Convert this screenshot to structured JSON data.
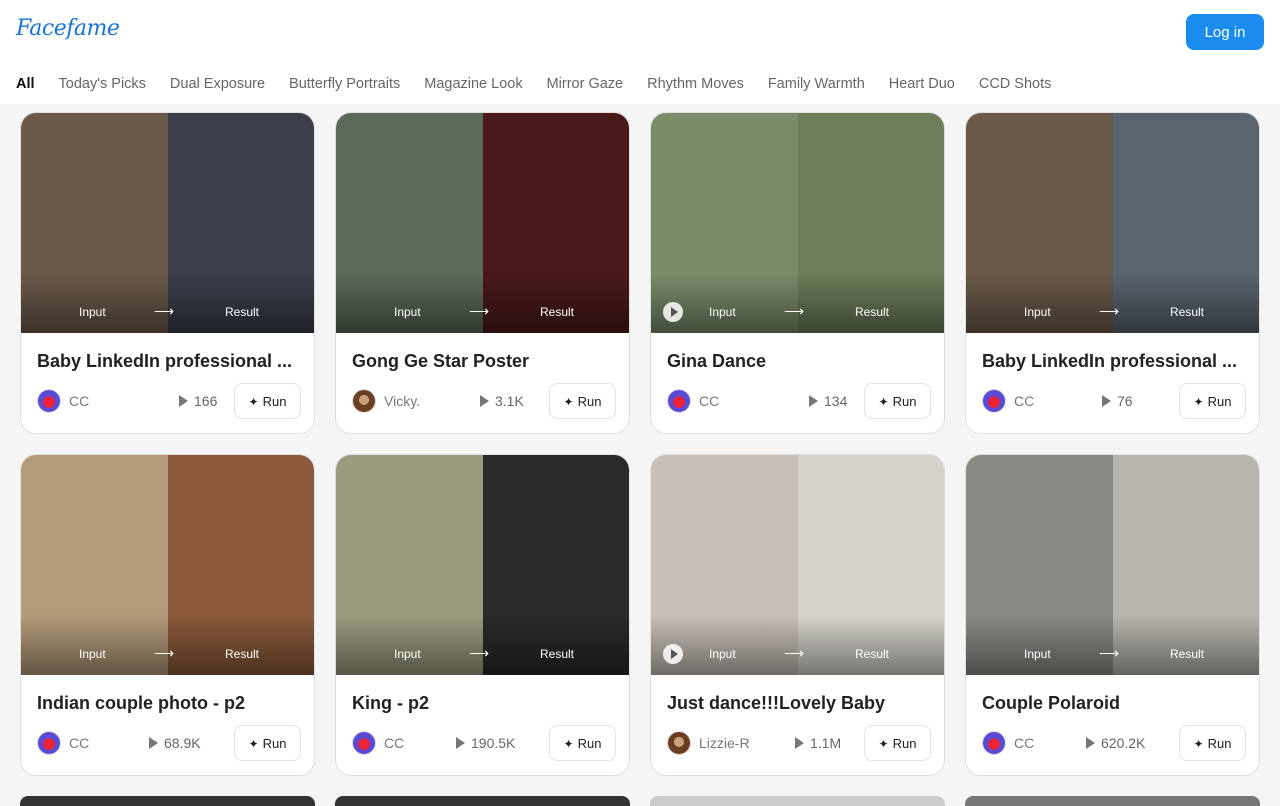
{
  "header": {
    "logo": "Facefame",
    "login_label": "Log in"
  },
  "tabs": [
    "All",
    "Today's Picks",
    "Dual Exposure",
    "Butterfly Portraits",
    "Magazine Look",
    "Mirror Gaze",
    "Rhythm Moves",
    "Family Warmth",
    "Heart Duo",
    "CCD Shots"
  ],
  "labels": {
    "input": "Input",
    "result": "Result",
    "arrow": "⟶",
    "run": "Run"
  },
  "cards": [
    {
      "title": "Baby LinkedIn professional ...",
      "author": "CC",
      "runs": "166",
      "video": false,
      "colors": [
        "#6b5a4a",
        "#3a3f4a"
      ]
    },
    {
      "title": "Gong Ge Star Poster",
      "author": "Vicky.",
      "runs": "3.1K",
      "video": false,
      "colors": [
        "#5c6a5a",
        "#4a1a1a"
      ]
    },
    {
      "title": "Gina Dance",
      "author": "CC",
      "runs": "134",
      "video": true,
      "colors": [
        "#7a8c6a",
        "#6d7d5a"
      ]
    },
    {
      "title": "Baby LinkedIn professional ...",
      "author": "CC",
      "runs": "76",
      "video": false,
      "colors": [
        "#6b5a4a",
        "#5a646e"
      ]
    },
    {
      "title": "Indian couple photo - p2",
      "author": "CC",
      "runs": "68.9K",
      "video": false,
      "colors": [
        "#b49b7a",
        "#8a5a3a"
      ]
    },
    {
      "title": "King - p2",
      "author": "CC",
      "runs": "190.5K",
      "video": false,
      "colors": [
        "#9c9a7e",
        "#2a2a2a"
      ]
    },
    {
      "title": "Just dance!!!Lovely Baby",
      "author": "Lizzie-R",
      "runs": "1.1M",
      "video": true,
      "colors": [
        "#c8c0b8",
        "#d6d2cc"
      ]
    },
    {
      "title": "Couple Polaroid",
      "author": "CC",
      "runs": "620.2K",
      "video": false,
      "colors": [
        "#8a8a84",
        "#b8b4ae"
      ]
    }
  ]
}
